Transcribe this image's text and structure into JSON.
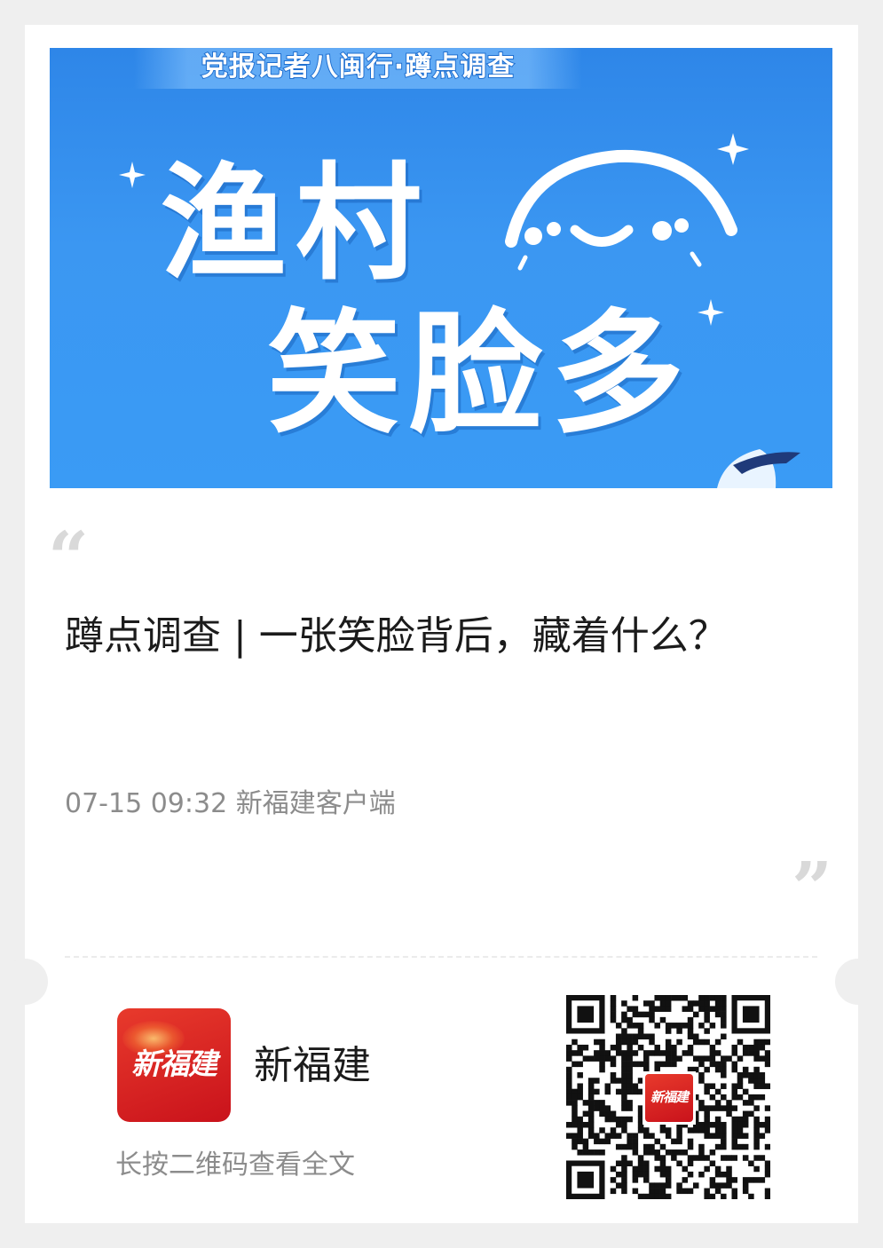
{
  "banner": {
    "kicker": "党报记者八闽行·蹲点调查",
    "headline_line1": "渔村",
    "headline_line2": "笑脸多"
  },
  "article": {
    "quote_open": "“",
    "quote_close": "”",
    "title": "蹲点调查 | 一张笑脸背后，藏着什么？",
    "meta": "07-15 09:32 新福建客户端"
  },
  "footer": {
    "app_logo_text": "新福建",
    "app_name": "新福建",
    "hint": "长按二维码查看全文",
    "qr_logo_text": "新福建"
  },
  "colors": {
    "banner_blue": "#3a9bf5",
    "brand_red": "#d7261f",
    "page_bg": "#efefef",
    "meta_gray": "#8c8c8c"
  }
}
